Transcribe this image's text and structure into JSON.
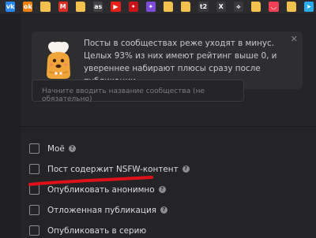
{
  "bookmarks": [
    {
      "name": "vk",
      "label": "vk",
      "color": "#2787f5"
    },
    {
      "name": "ok",
      "label": "ok",
      "color": "#ee8208"
    },
    {
      "name": "folder",
      "label": "",
      "color": "#f2c14e"
    },
    {
      "name": "gmail",
      "label": "M",
      "color": "#d93025"
    },
    {
      "name": "folder",
      "label": "",
      "color": "#f2c14e"
    },
    {
      "name": "lastfm",
      "label": "as",
      "color": "#444447"
    },
    {
      "name": "youtube",
      "label": "▶",
      "color": "#e62117"
    },
    {
      "name": "red-app",
      "label": "•",
      "color": "#c9151a"
    },
    {
      "name": "colorful-app",
      "label": "✦",
      "color": "#7d4bd8"
    },
    {
      "name": "folder",
      "label": "",
      "color": "#f2c14e"
    },
    {
      "name": "folder",
      "label": "",
      "color": "#f2c14e"
    },
    {
      "name": "t2",
      "label": "t2",
      "color": "#3a3a3d"
    },
    {
      "name": "x",
      "label": "X",
      "color": "#3a3a3d"
    },
    {
      "name": "network",
      "label": "⟡",
      "color": "#3a3a3d"
    },
    {
      "name": "folder",
      "label": "",
      "color": "#f2c14e"
    },
    {
      "name": "pocket",
      "label": "◡",
      "color": "#ef4056"
    },
    {
      "name": "folder",
      "label": "",
      "color": "#f2c14e"
    },
    {
      "name": "telegram",
      "label": "➤",
      "color": "#2aabee"
    }
  ],
  "notice": {
    "text": "Посты в сообществах реже уходят в минус. Целых 93% из них имеют рейтинг выше 0, и увереннее набирают плюсы сразу после публикации.",
    "close_label": "✕"
  },
  "community_input": {
    "placeholder": "Начните вводить название сообщества (не обязательно)"
  },
  "options": [
    {
      "id": "mine",
      "label": "Моё",
      "help": true,
      "checked": false
    },
    {
      "id": "nsfw",
      "label": "Пост содержит NSFW-контент",
      "help": true,
      "checked": false
    },
    {
      "id": "anonymous",
      "label": "Опубликовать анонимно",
      "help": true,
      "checked": false
    },
    {
      "id": "delayed",
      "label": "Отложенная публикация",
      "help": true,
      "checked": false
    },
    {
      "id": "series",
      "label": "Опубликовать в серию",
      "help": false,
      "checked": false
    }
  ],
  "help_glyph": "?",
  "colors": {
    "background": "#242426",
    "annotation": "#e0101a",
    "checkbox_border": "#8c8c90"
  }
}
